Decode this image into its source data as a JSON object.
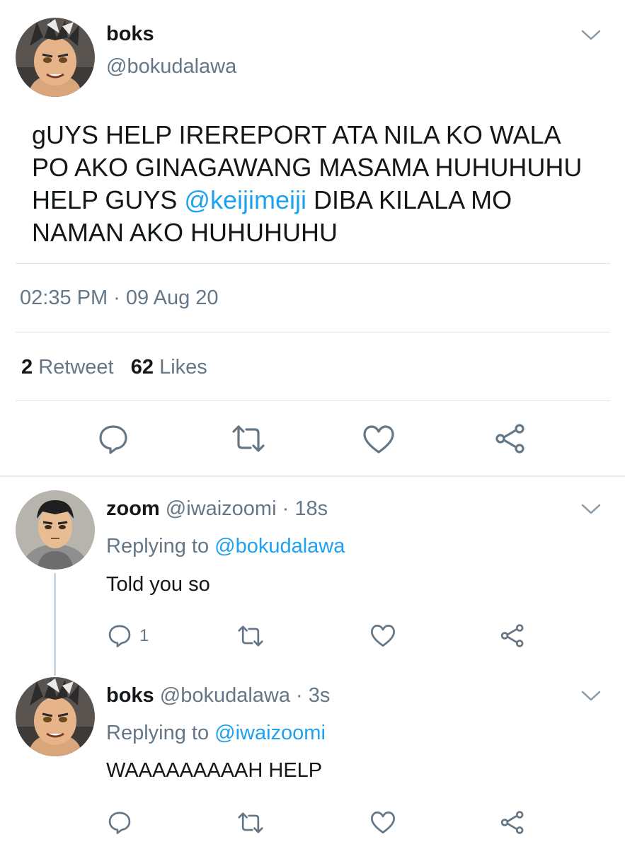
{
  "main_tweet": {
    "display_name": "boks",
    "handle": "@bokudalawa",
    "text_before_mention": "gUYS HELP IREREPORT ATA NILA KO WALA PO AKO GINAGAWANG MASAMA HUHUHUHU HELP GUYS ",
    "mention": "@keijimeiji",
    "text_after_mention": " DIBA KILALA MO NAMAN AKO HUHUHUHU",
    "timestamp": "02:35 PM · 09 Aug 20",
    "retweet_count": "2",
    "retweet_label": "Retweet",
    "like_count": "62",
    "like_label": "Likes"
  },
  "replies": [
    {
      "display_name": "zoom",
      "handle": "@iwaizoomi",
      "time": "· 18s",
      "replying_label": "Replying to",
      "replying_to": "@bokudalawa",
      "text": "Told you so",
      "reply_count": "1"
    },
    {
      "display_name": "boks",
      "handle": "@bokudalawa",
      "time": "· 3s",
      "replying_label": "Replying to",
      "replying_to": "@iwaizoomi",
      "text": "WAAAAAAAAAH HELP",
      "reply_count": ""
    }
  ],
  "icons": {
    "reply": "speech-bubble-icon",
    "retweet": "retweet-arrows-icon",
    "like": "heart-icon",
    "share": "share-nodes-icon",
    "more": "chevron-down-icon"
  },
  "colors": {
    "link": "#1da1f2",
    "secondary_text": "#657786",
    "divider": "#e1e8ed",
    "icon": "#657786"
  }
}
